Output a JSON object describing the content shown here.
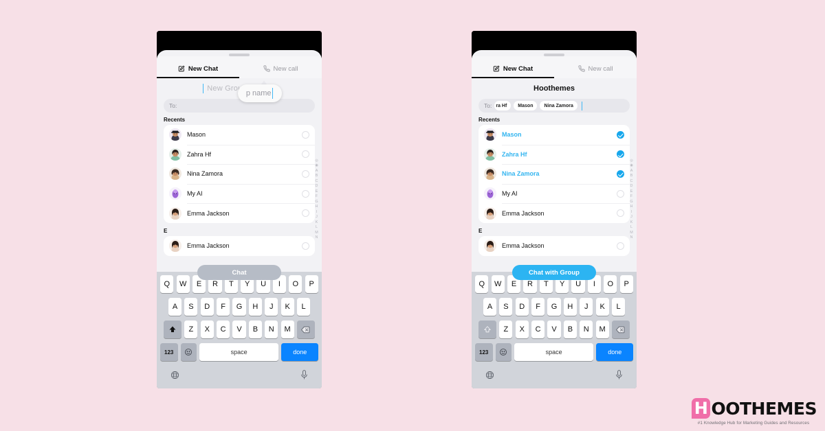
{
  "page": {
    "background_color": "#f7e0e7"
  },
  "phones": [
    {
      "id": "left",
      "tabs": {
        "new_chat": "New Chat",
        "new_call": "New call",
        "active": "New Chat"
      },
      "group_title": {
        "placeholder": "New Group name",
        "value": "",
        "edit_icon": "pencil-icon"
      },
      "magnifier": {
        "visible": true,
        "text": "p name"
      },
      "to_field": {
        "label": "To:",
        "chips": []
      },
      "recents_label": "Recents",
      "contacts": [
        {
          "name": "Mason",
          "selected": false,
          "avatar": "mason"
        },
        {
          "name": "Zahra Hf",
          "selected": false,
          "avatar": "zahra"
        },
        {
          "name": "Nina Zamora",
          "selected": false,
          "avatar": "nina"
        },
        {
          "name": "My AI",
          "selected": false,
          "avatar": "myai"
        },
        {
          "name": "Emma Jackson",
          "selected": false,
          "avatar": "emma"
        }
      ],
      "section_letter": "E",
      "section_contact": {
        "name": "Emma Jackson",
        "selected": false,
        "avatar": "emma"
      },
      "cta": {
        "label": "Chat",
        "state": "disabled",
        "color": "#b6bcc6"
      },
      "keyboard": {
        "shift_state": "active"
      }
    },
    {
      "id": "right",
      "tabs": {
        "new_chat": "New Chat",
        "new_call": "New call",
        "active": "New Chat"
      },
      "group_title": {
        "placeholder": "New Group name",
        "value": "Hoothemes",
        "edit_icon": "pencil-icon"
      },
      "magnifier": {
        "visible": false,
        "text": ""
      },
      "to_field": {
        "label": "To:",
        "chips": [
          "ra Hf",
          "Mason",
          "Nina Zamora"
        ]
      },
      "recents_label": "Recents",
      "contacts": [
        {
          "name": "Mason",
          "selected": true,
          "avatar": "mason"
        },
        {
          "name": "Zahra Hf",
          "selected": true,
          "avatar": "zahra"
        },
        {
          "name": "Nina Zamora",
          "selected": true,
          "avatar": "nina"
        },
        {
          "name": "My AI",
          "selected": false,
          "avatar": "myai"
        },
        {
          "name": "Emma Jackson",
          "selected": false,
          "avatar": "emma"
        }
      ],
      "section_letter": "E",
      "section_contact": {
        "name": "Emma Jackson",
        "selected": false,
        "avatar": "emma"
      },
      "cta": {
        "label": "Chat with Group",
        "state": "active",
        "color": "#2cb4f2"
      },
      "keyboard": {
        "shift_state": "inactive"
      }
    }
  ],
  "index_strip": {
    "icons": [
      "search-icon",
      "star-icon"
    ],
    "letters": [
      "A",
      "B",
      "C",
      "D",
      "E",
      "F",
      "G",
      "H",
      "I",
      "J",
      "K",
      "L",
      "M",
      "N"
    ]
  },
  "keyboard": {
    "row1": [
      "Q",
      "W",
      "E",
      "R",
      "T",
      "Y",
      "U",
      "I",
      "O",
      "P"
    ],
    "row2": [
      "A",
      "S",
      "D",
      "F",
      "G",
      "H",
      "J",
      "K",
      "L"
    ],
    "row3": [
      "Z",
      "X",
      "C",
      "V",
      "B",
      "N",
      "M"
    ],
    "numbers_key": "123",
    "emoji_key": "☺",
    "space_key": "space",
    "done_key": "done",
    "shift_key": "shift-icon",
    "backspace_key": "backspace-icon",
    "globe_key": "globe-icon",
    "mic_key": "microphone-icon"
  },
  "logo": {
    "mark": "H",
    "name": "OOTHEMES",
    "tagline": "#1 Knowledge Hub for Marketing Guides and Resources",
    "accent_color": "#f06ea9"
  }
}
